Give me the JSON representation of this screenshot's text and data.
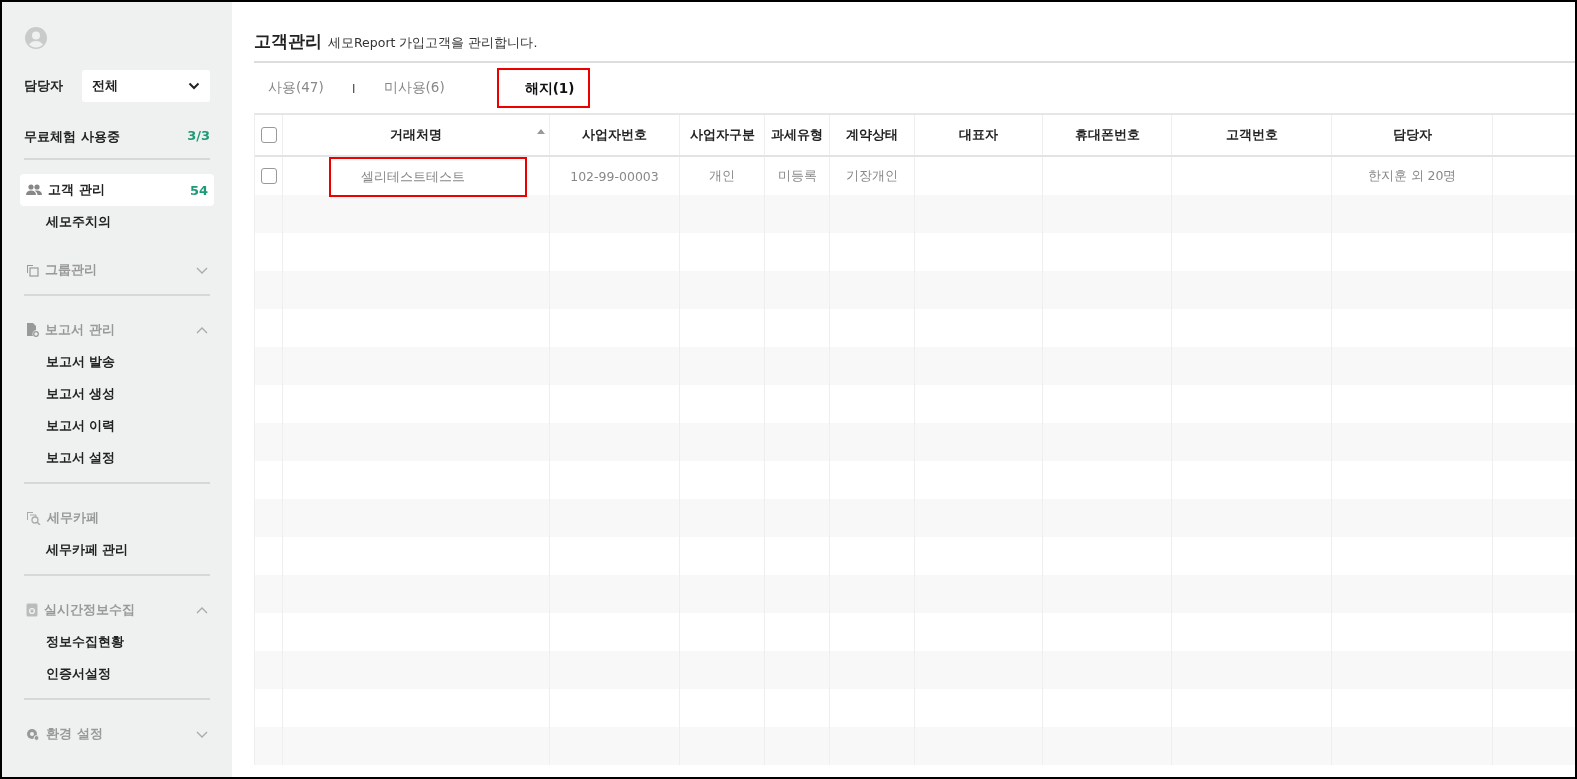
{
  "sidebar": {
    "manager": {
      "label": "담당자",
      "value": "전체"
    },
    "trial": {
      "label": "무료체험 사용중",
      "count": "3/3"
    },
    "sections": [
      {
        "label": "고객 관리",
        "selected": true,
        "count": "54",
        "children": [
          {
            "label": "세모주치의",
            "selected": false
          }
        ]
      },
      {
        "label": "그룹관리",
        "selected": false,
        "expanded": false
      },
      {
        "label": "보고서 관리",
        "selected": false,
        "expanded": true,
        "children": [
          {
            "label": "보고서 발송",
            "selected": false
          },
          {
            "label": "보고서 생성",
            "selected": false
          },
          {
            "label": "보고서 이력",
            "selected": false
          },
          {
            "label": "보고서 설정",
            "selected": false
          }
        ]
      },
      {
        "label": "세무카페",
        "selected": false,
        "children": [
          {
            "label": "세무카페 관리",
            "selected": false
          }
        ]
      },
      {
        "label": "실시간정보수집",
        "selected": false,
        "expanded": true,
        "children": [
          {
            "label": "정보수집현황",
            "selected": false
          },
          {
            "label": "인증서설정",
            "selected": false
          }
        ]
      },
      {
        "label": "환경 설정",
        "selected": false,
        "expanded": false
      }
    ]
  },
  "header": {
    "title": "고객관리",
    "description": "세모Report 가입고객을 관리합니다."
  },
  "tabs": [
    {
      "label": "사용(47)",
      "selected": false,
      "separator": "I"
    },
    {
      "label": "미사용(6)",
      "selected": false
    },
    {
      "label": "해지(1)",
      "selected": true,
      "highlighted": true
    }
  ],
  "table": {
    "select_all": {
      "checked": false
    },
    "columns": [
      {
        "label": "거래처명",
        "sorted": true
      },
      {
        "label": "사업자번호",
        "sorted": false
      },
      {
        "label": "사업자구분",
        "sorted": false
      },
      {
        "label": "과세유형",
        "sorted": false
      },
      {
        "label": "계약상태",
        "sorted": false
      },
      {
        "label": "대표자",
        "sorted": false
      },
      {
        "label": "휴대폰번호",
        "sorted": false
      },
      {
        "label": "고객번호",
        "sorted": false
      },
      {
        "label": "담당자",
        "sorted": false
      }
    ],
    "rows": [
      {
        "checked": false,
        "highlighted": true,
        "cells": [
          "셀리테스트테스트",
          "102-99-00003",
          "개인",
          "미등록",
          "기장개인",
          null,
          null,
          null,
          "한지훈 외 20명"
        ]
      }
    ]
  }
}
